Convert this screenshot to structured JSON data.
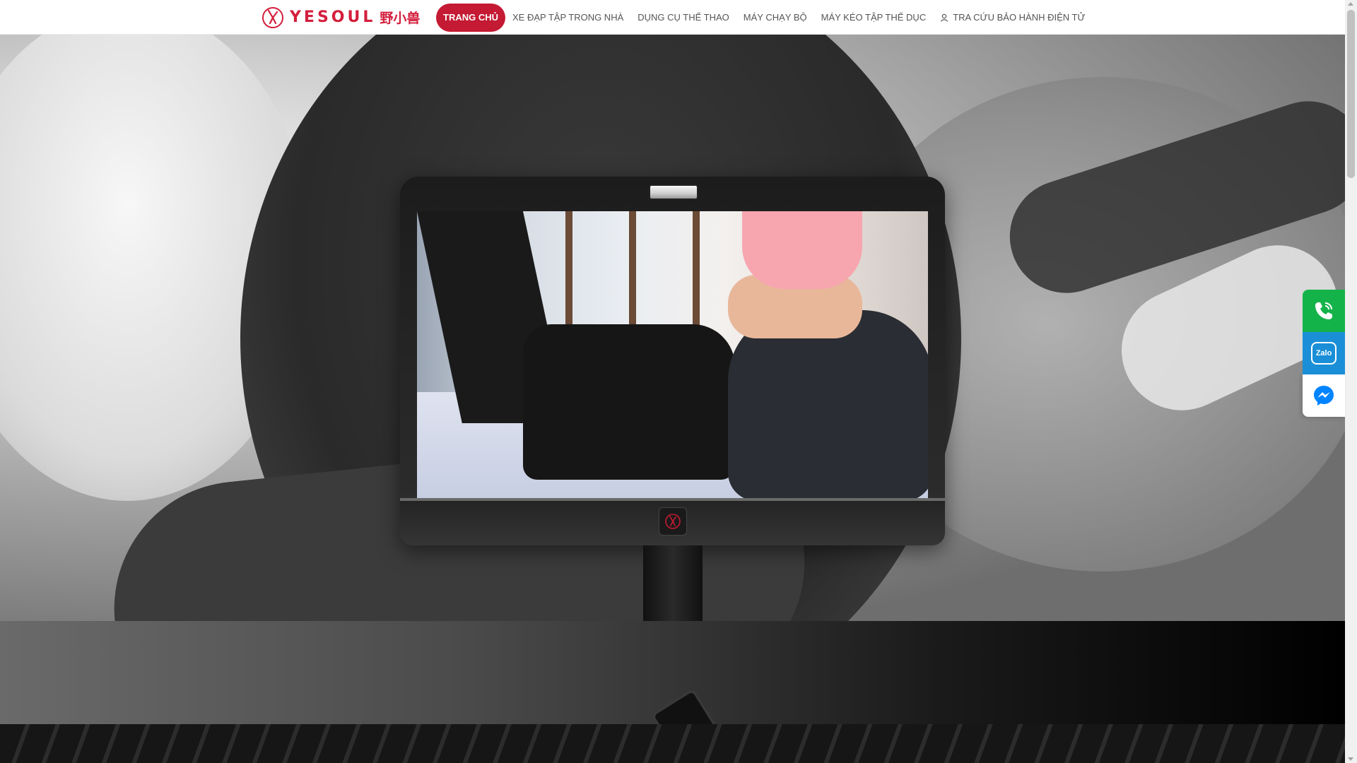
{
  "header": {
    "logo_text": "YESOUL",
    "logo_cn": "野小兽",
    "nav": [
      {
        "label": "TRANG CHỦ",
        "active": true
      },
      {
        "label": "XE ĐẠP TẬP TRONG NHÀ",
        "active": false
      },
      {
        "label": "DỤNG CỤ THỂ THAO",
        "active": false
      },
      {
        "label": "MÁY CHẠY BỘ",
        "active": false
      },
      {
        "label": "MÁY KÉO TẬP THỂ DỤC",
        "active": false
      },
      {
        "label": "TRA CỨU BẢO HÀNH ĐIỆN TỬ",
        "active": false,
        "icon": "user-icon"
      }
    ]
  },
  "contacts": {
    "phone_icon": "phone-icon",
    "zalo_label": "Zalo",
    "messenger_icon": "messenger-icon"
  },
  "colors": {
    "brand": "#d31f3c",
    "active_nav": "#c41a33",
    "phone_green": "#14b34a",
    "zalo_blue": "#1a8fd8",
    "messenger_blue": "#0084ff"
  }
}
